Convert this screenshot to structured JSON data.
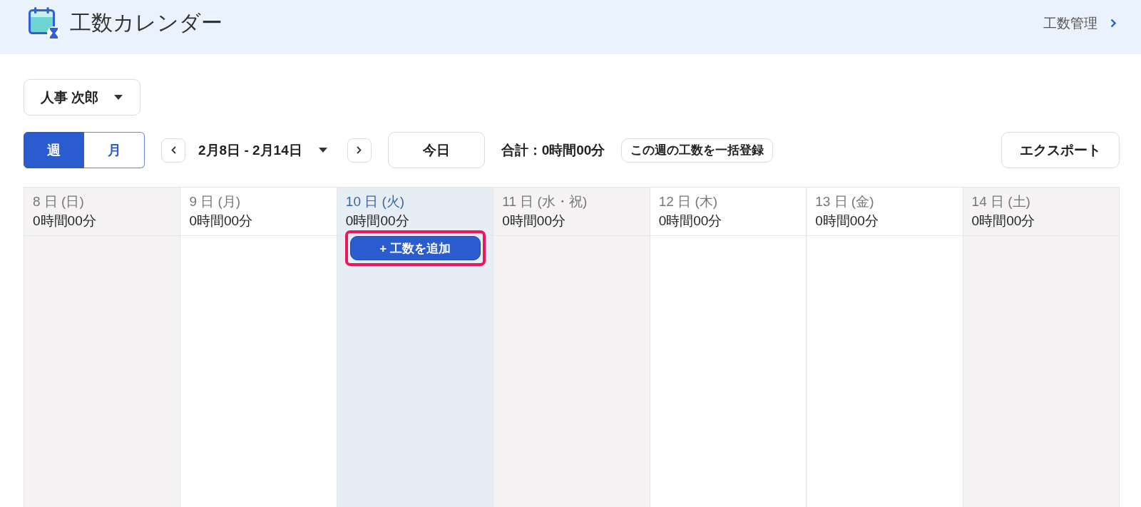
{
  "header": {
    "title": "工数カレンダー",
    "link": "工数管理"
  },
  "user_select": {
    "value": "人事 次郎"
  },
  "view_tabs": [
    {
      "label": "週",
      "selected": true
    },
    {
      "label": "月",
      "selected": false
    }
  ],
  "date_range": {
    "value": "2月8日 - 2月14日"
  },
  "today_button": "今日",
  "total": "合計：0時間00分",
  "bulk_register_button": "この週の工数を一括登録",
  "export_button": "エクスポート",
  "days": [
    {
      "date": "8 日 (日)",
      "total": "0時間00分",
      "kind": "holiday",
      "selected": false
    },
    {
      "date": "9 日 (月)",
      "total": "0時間00分",
      "kind": "workday",
      "selected": false
    },
    {
      "date": "10 日 (火)",
      "total": "0時間00分",
      "kind": "workday",
      "selected": true,
      "add_button": {
        "label": "+ 工数を追加",
        "highlighted": true
      }
    },
    {
      "date": "11 日 (水・祝)",
      "total": "0時間00分",
      "kind": "holiday",
      "selected": false
    },
    {
      "date": "12 日 (木)",
      "total": "0時間00分",
      "kind": "workday",
      "selected": false
    },
    {
      "date": "13 日 (金)",
      "total": "0時間00分",
      "kind": "workday",
      "selected": false
    },
    {
      "date": "14 日 (土)",
      "total": "0時間00分",
      "kind": "holiday",
      "selected": false
    }
  ]
}
